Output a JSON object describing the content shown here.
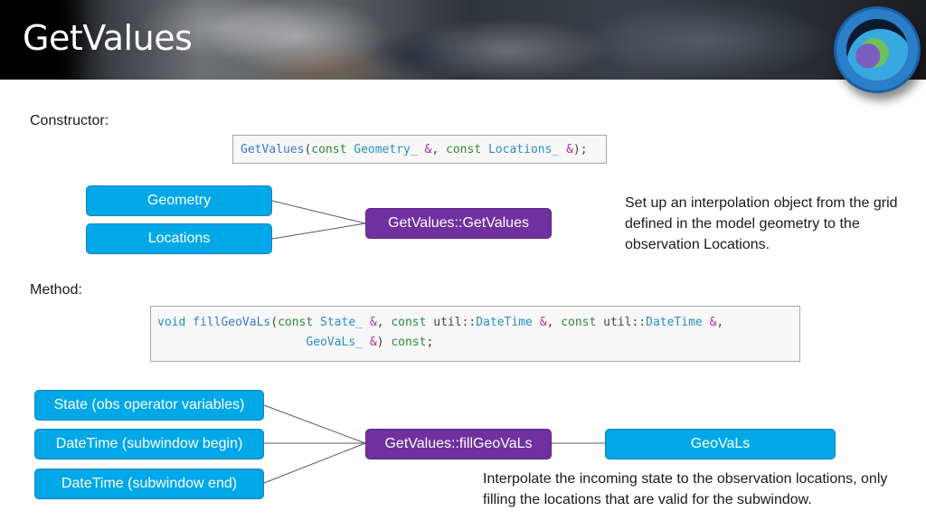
{
  "header": {
    "title": "GetValues",
    "logo_icon": "jcsda-logo-icon"
  },
  "constructor": {
    "label": "Constructor:",
    "code": {
      "name": "GetValues",
      "open": "(",
      "kw1": "const",
      "type1": "Geometry_",
      "amp1": "&",
      "sep": ", ",
      "kw2": "const",
      "type2": "Locations_",
      "amp2": "&",
      "close": ");"
    },
    "inputs": [
      "Geometry",
      "Locations"
    ],
    "target": "GetValues::GetValues",
    "description": "Set up an interpolation object from the grid defined in the model geometry to the observation Locations."
  },
  "method": {
    "label": "Method:",
    "code": {
      "ret": "void",
      "name": "fillGeoVaLs",
      "open": "(",
      "kw1": "const",
      "type1": "State_",
      "amp1": "&",
      "sep1": ", ",
      "kw2": "const",
      "ns2": "util::",
      "type2": "DateTime",
      "amp2": "&",
      "sep2": ", ",
      "kw3": "const",
      "ns3": "util::",
      "type3": "DateTime",
      "amp3": "&",
      "trail": ",",
      "type4": "GeoVaLs_",
      "amp4": "&",
      "close_paren": ")",
      "kw_end": "const",
      "semi": ";"
    },
    "inputs": [
      "State (obs operator variables)",
      "DateTime (subwindow begin)",
      "DateTime (subwindow end)"
    ],
    "target": "GetValues::fillGeoVaLs",
    "output": "GeoVaLs",
    "description": "Interpolate the incoming state to the observation locations, only filling the locations that are valid for the subwindow."
  },
  "colors": {
    "input_node": "#00a8e8",
    "function_node": "#7030a0",
    "keyword": "#2d8a3e",
    "type": "#2a8fc4",
    "ampersand": "#b02ea8"
  }
}
